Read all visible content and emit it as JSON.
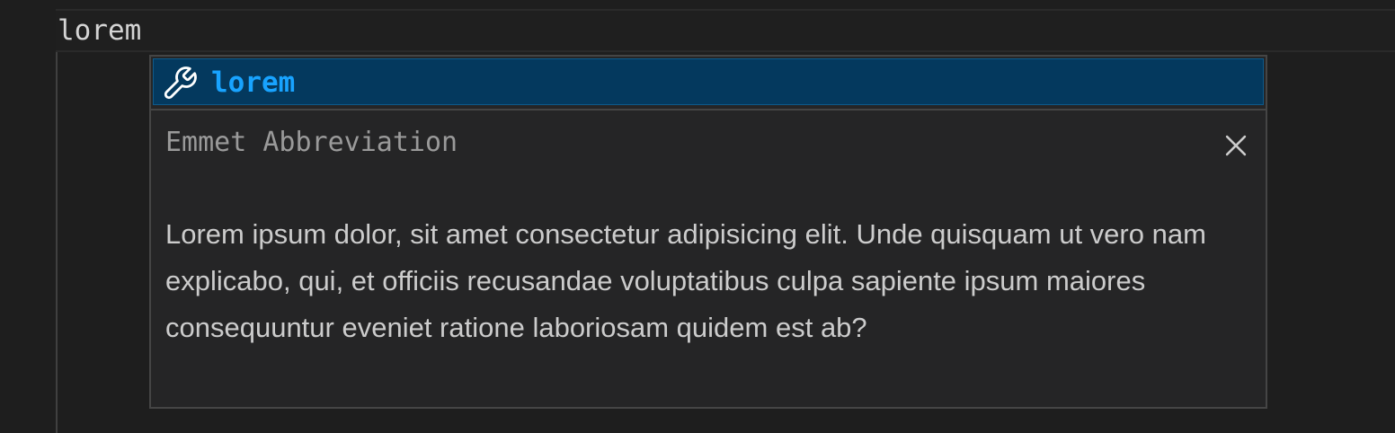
{
  "editor": {
    "line_text": "lorem"
  },
  "suggest": {
    "items": [
      {
        "icon": "wrench-icon",
        "label": "lorem",
        "selected": true
      }
    ]
  },
  "details": {
    "title": "Emmet Abbreviation",
    "close_icon": "close-icon",
    "documentation": "Lorem ipsum dolor, sit amet consectetur adipisicing elit. Unde quisquam ut vero nam explicabo, qui, et officiis recusandae voluptatibus culpa sapiente ipsum maiores consequuntur eveniet ratione laboriosam quidem est ab?"
  },
  "colors": {
    "editor_background": "#1e1e1e",
    "widget_background": "#252526",
    "selected_background": "#04395e",
    "highlight_text": "#18a3ff",
    "border": "#454545"
  }
}
